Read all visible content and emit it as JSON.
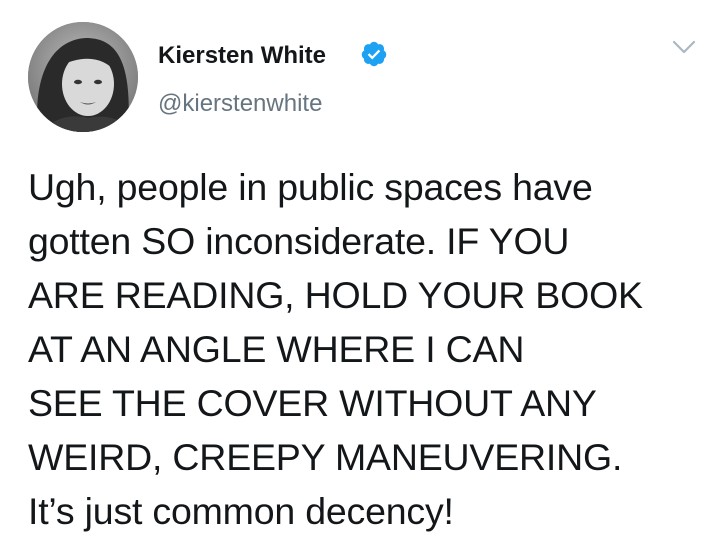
{
  "tweet": {
    "display_name": "Kiersten White",
    "handle": "@kierstenwhite",
    "verified": true,
    "text_lines": [
      "Ugh, people in public spaces have",
      "gotten SO inconsiderate. IF YOU",
      "ARE READING, HOLD YOUR BOOK",
      "AT AN ANGLE WHERE I CAN",
      "SEE THE COVER WITHOUT ANY",
      "WEIRD, CREEPY MANEUVERING.",
      "It’s just common decency!"
    ]
  },
  "icons": {
    "verified": "verified-badge-icon",
    "caret": "chevron-down-icon"
  },
  "colors": {
    "verified_blue": "#1da1f2",
    "handle_gray": "#66757f",
    "text": "#14171a",
    "caret_gray": "#aab8c2"
  }
}
